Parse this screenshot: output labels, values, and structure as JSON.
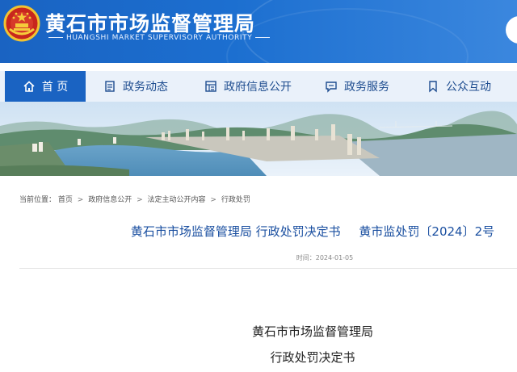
{
  "header": {
    "title": "黄石市市场监督管理局",
    "subtitle": "HUANGSHI MARKET SUPERVISORY AUTHORITY"
  },
  "nav": {
    "items": [
      {
        "label": "首 页",
        "icon": "home-icon",
        "active": true
      },
      {
        "label": "政务动态",
        "icon": "document-icon",
        "active": false
      },
      {
        "label": "政府信息公开",
        "icon": "info-grid-icon",
        "active": false
      },
      {
        "label": "政务服务",
        "icon": "chat-service-icon",
        "active": false
      },
      {
        "label": "公众互动",
        "icon": "bookmark-icon",
        "active": false
      }
    ]
  },
  "breadcrumb": {
    "prefix": "当前位置：",
    "items": [
      "首页",
      "政府信息公开",
      "法定主动公开内容",
      "行政处罚"
    ],
    "separator": ">"
  },
  "article": {
    "title": "黄石市市场监督管理局 行政处罚决定书",
    "doc_number": "黄市监处罚〔2024〕2号",
    "date": "时间：2024-01-05",
    "body_line1": "黄石市市场监督管理局",
    "body_line2": "行政处罚决定书"
  },
  "colors": {
    "brand_blue": "#1a63c2",
    "title_blue": "#1a4fa0",
    "nav_bg": "#e8f0fa"
  }
}
